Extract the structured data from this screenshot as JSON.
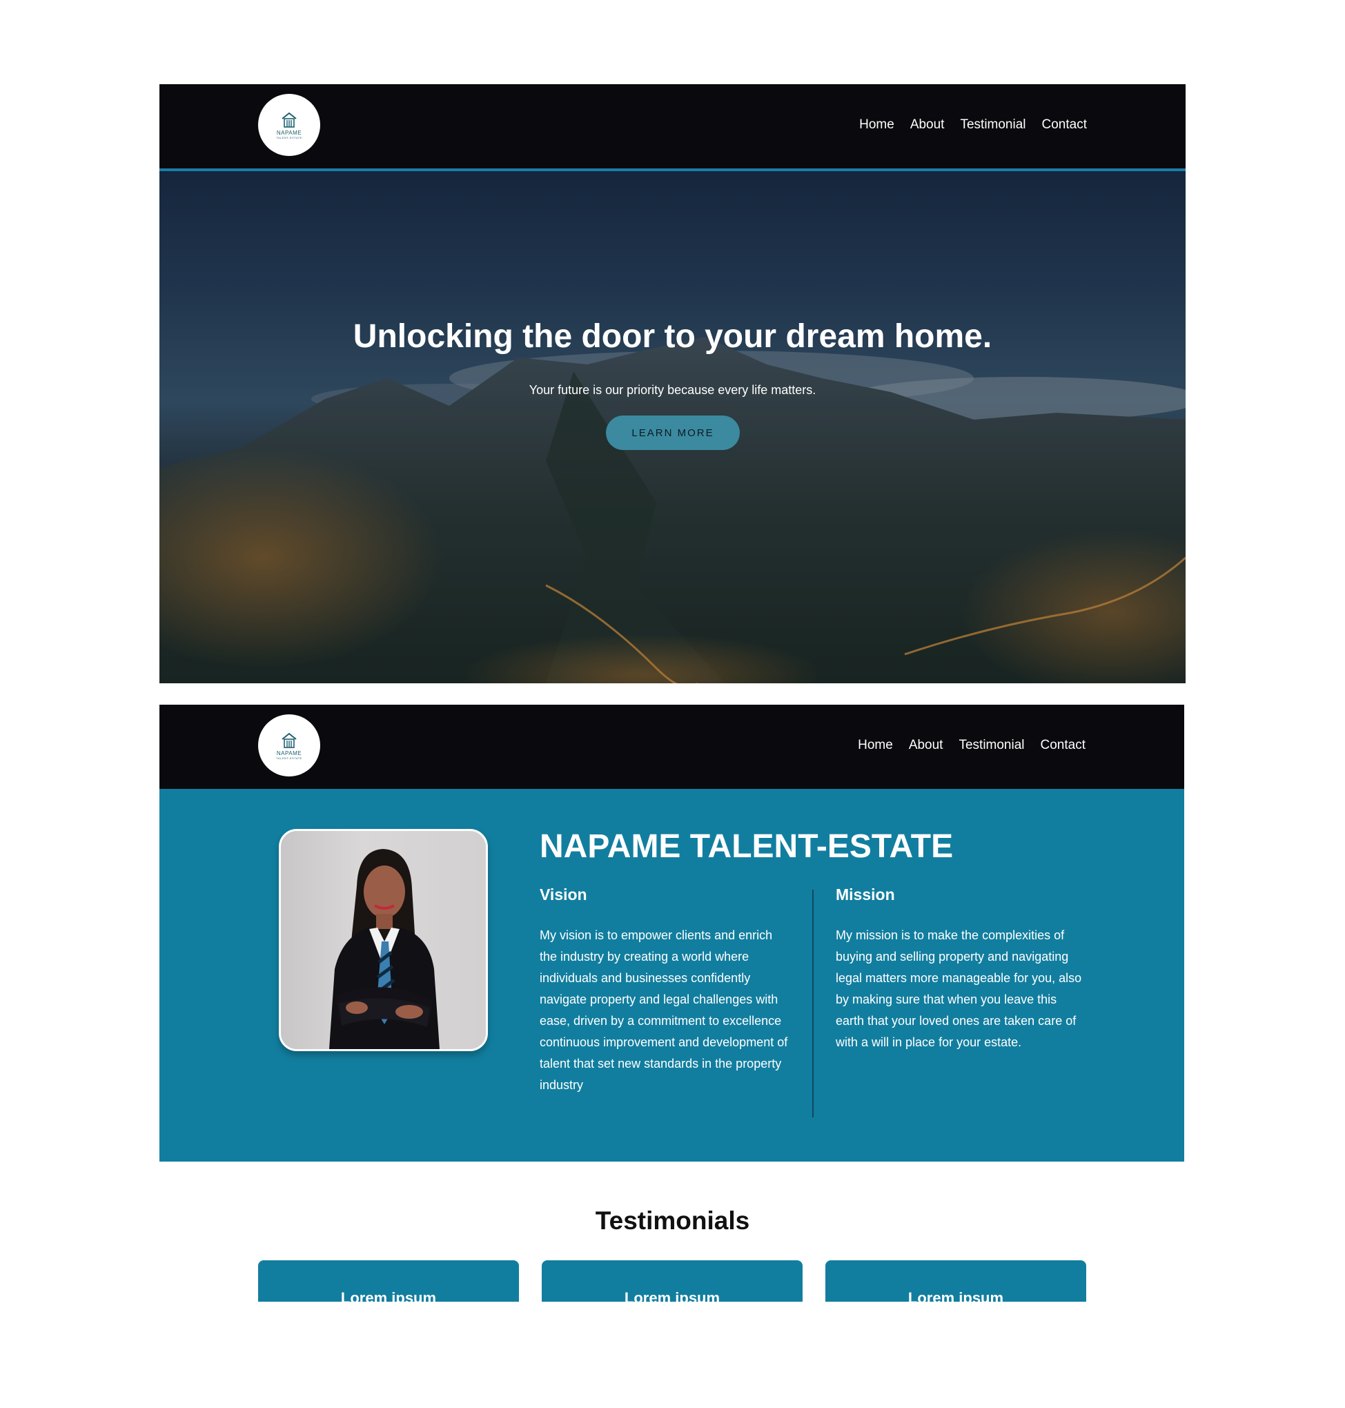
{
  "nav": {
    "logo_name": "NAPAME",
    "logo_sub": "TALENT-ESTATE",
    "items": [
      "Home",
      "About",
      "Testimonial",
      "Contact"
    ]
  },
  "hero": {
    "title": "Unlocking the door to your dream home.",
    "subtitle": "Your future is our priority because every life matters.",
    "button": "LEARN MORE"
  },
  "about": {
    "title": "NAPAME TALENT-ESTATE",
    "vision": {
      "heading": "Vision",
      "text": "My vision is to empower clients and enrich the industry by creating a world where individuals and businesses confidently navigate property and legal challenges with ease, driven by a commitment to excellence continuous improvement and development of talent that set new standards in the property industry"
    },
    "mission": {
      "heading": "Mission",
      "text": "My mission is to make the complexities of buying and selling property and navigating legal matters more manageable for you, also by making sure that when you leave this earth that your loved ones are taken care of with a will in place for your estate."
    }
  },
  "testimonials": {
    "title": "Testimonials",
    "cards": [
      {
        "title": "Lorem ipsum"
      },
      {
        "title": "Lorem ipsum"
      },
      {
        "title": "Lorem ipsum"
      }
    ]
  },
  "colors": {
    "header_bg": "#0a0a0e",
    "accent": "#127e9f",
    "button": "#3b8aa0"
  }
}
